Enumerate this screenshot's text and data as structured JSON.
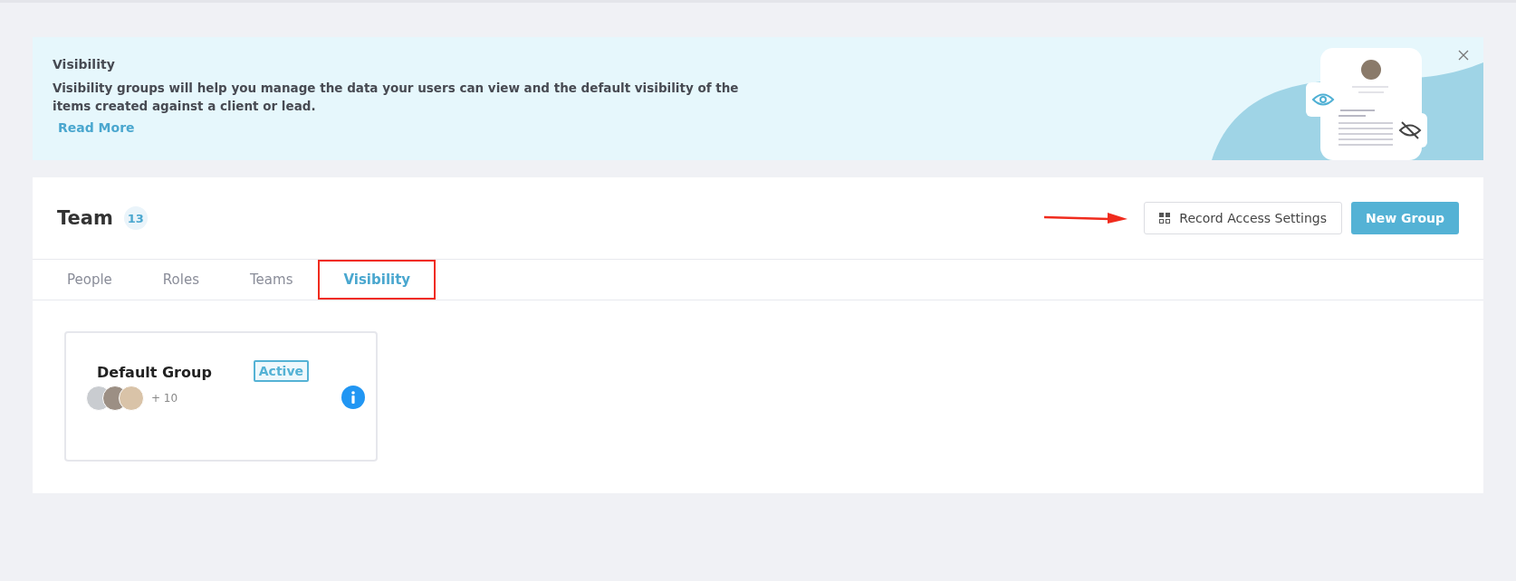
{
  "banner": {
    "title": "Visibility",
    "text": "Visibility groups will help you manage the data your users can view and the default visibility of the items created against a client or lead.",
    "link": "Read More"
  },
  "team": {
    "title": "Team",
    "count": "13",
    "arrow_annotation": true,
    "buttons": [
      {
        "kind": "secondary",
        "label": "Record Access Settings"
      },
      {
        "kind": "primary",
        "label": "New Group"
      }
    ]
  },
  "tabs": [
    {
      "label": "People",
      "selected": false,
      "highlighted": false
    },
    {
      "label": "Roles",
      "selected": false,
      "highlighted": false
    },
    {
      "label": "Teams",
      "selected": false,
      "highlighted": false
    },
    {
      "label": "Visibility",
      "selected": true,
      "highlighted": true
    }
  ],
  "groups": [
    {
      "name": "Default Group",
      "status": "Active",
      "more_members": "+ 10"
    }
  ]
}
